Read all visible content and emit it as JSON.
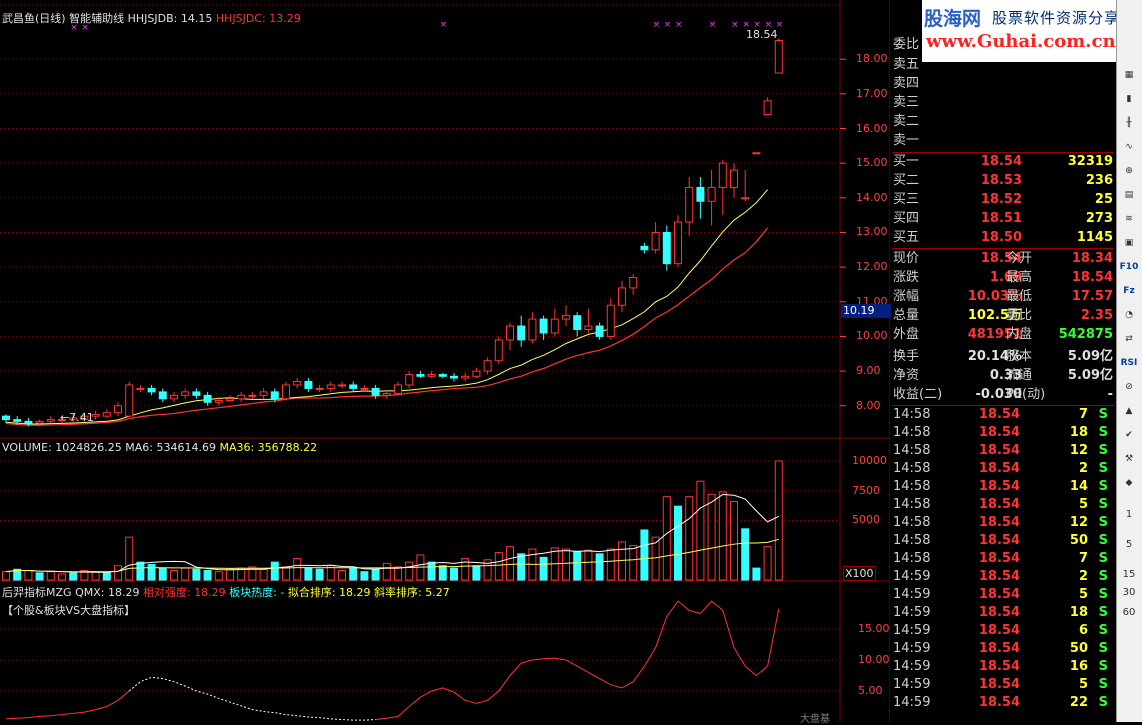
{
  "colors": {
    "up": "#ff3333",
    "down": "#33ffff",
    "ma_short": "#ffff66",
    "ma_long": "#ff3333",
    "grid": "#8b0000"
  },
  "main_chart": {
    "header": {
      "title": "武昌鱼(日线)",
      "indicator": "智能辅助线",
      "hhjsjdb_label": "HHJSJDB: 14.15",
      "hhjsjdc_label": "HHJSJDC: 13.29"
    },
    "price_axis": [
      "18.00",
      "17.00",
      "16.00",
      "15.00",
      "14.00",
      "13.00",
      "12.00",
      "11.00",
      "10.00",
      "9.00",
      "8.00"
    ],
    "current_price_tag": "10.19",
    "high_annotation": "18.54",
    "low_annotation": "7.41"
  },
  "volume_chart": {
    "header": {
      "volume": "VOLUME: 1024826.25",
      "ma6": "MA6: 534614.69",
      "ma36": "MA36: 356788.22"
    },
    "axis": [
      "10000",
      "7500",
      "5000"
    ],
    "unit": "X100"
  },
  "indicator_chart": {
    "header": {
      "name": "后羿指标MZG",
      "qmx": "QMX: 18.29",
      "rel_strength": "相对强度: 18.29",
      "sector_heat": "板块热度: -",
      "fit_rank": "拟合排序: 18.29",
      "slope_rank": "斜率排序: 5.27"
    },
    "subtitle": "【个股&板块VS大盘指标】",
    "axis": [
      "15.00",
      "10.00",
      "5.00"
    ],
    "corner_label": "大盘基"
  },
  "chart_data": [
    {
      "type": "candlestick",
      "title": "武昌鱼(日线)",
      "ylim": [
        7.3,
        18.9
      ],
      "candles": [
        [
          7.7,
          7.6,
          7.75,
          7.5
        ],
        [
          7.6,
          7.55,
          7.7,
          7.45
        ],
        [
          7.55,
          7.5,
          7.65,
          7.4
        ],
        [
          7.5,
          7.55,
          7.6,
          7.41
        ],
        [
          7.55,
          7.6,
          7.7,
          7.5
        ],
        [
          7.6,
          7.6,
          7.7,
          7.5
        ],
        [
          7.6,
          7.65,
          7.75,
          7.5
        ],
        [
          7.6,
          7.7,
          7.8,
          7.55
        ],
        [
          7.7,
          7.75,
          7.85,
          7.6
        ],
        [
          7.7,
          7.8,
          7.9,
          7.65
        ],
        [
          7.8,
          8.0,
          8.1,
          7.7
        ],
        [
          7.7,
          8.6,
          8.7,
          7.7
        ],
        [
          8.5,
          8.5,
          8.6,
          8.4
        ],
        [
          8.5,
          8.4,
          8.6,
          8.3
        ],
        [
          8.4,
          8.2,
          8.5,
          8.1
        ],
        [
          8.2,
          8.3,
          8.4,
          8.1
        ],
        [
          8.3,
          8.4,
          8.5,
          8.2
        ],
        [
          8.4,
          8.3,
          8.5,
          8.2
        ],
        [
          8.3,
          8.1,
          8.4,
          8.0
        ],
        [
          8.1,
          8.15,
          8.25,
          8.0
        ],
        [
          8.15,
          8.2,
          8.3,
          8.1
        ],
        [
          8.2,
          8.3,
          8.4,
          8.1
        ],
        [
          8.3,
          8.3,
          8.4,
          8.2
        ],
        [
          8.3,
          8.4,
          8.5,
          8.2
        ],
        [
          8.4,
          8.2,
          8.5,
          8.1
        ],
        [
          8.2,
          8.6,
          8.7,
          8.15
        ],
        [
          8.6,
          8.7,
          8.8,
          8.5
        ],
        [
          8.7,
          8.5,
          8.8,
          8.4
        ],
        [
          8.5,
          8.5,
          8.6,
          8.4
        ],
        [
          8.5,
          8.6,
          8.7,
          8.4
        ],
        [
          8.6,
          8.6,
          8.7,
          8.5
        ],
        [
          8.6,
          8.5,
          8.7,
          8.4
        ],
        [
          8.5,
          8.5,
          8.6,
          8.4
        ],
        [
          8.5,
          8.3,
          8.6,
          8.2
        ],
        [
          8.3,
          8.35,
          8.4,
          8.2
        ],
        [
          8.35,
          8.6,
          8.7,
          8.3
        ],
        [
          8.6,
          8.9,
          9.0,
          8.5
        ],
        [
          8.9,
          8.85,
          9.0,
          8.8
        ],
        [
          8.85,
          8.9,
          9.0,
          8.8
        ],
        [
          8.9,
          8.85,
          8.95,
          8.8
        ],
        [
          8.85,
          8.8,
          8.95,
          8.7
        ],
        [
          8.8,
          8.85,
          8.95,
          8.7
        ],
        [
          8.85,
          9.0,
          9.1,
          8.8
        ],
        [
          9.0,
          9.3,
          9.4,
          8.9
        ],
        [
          9.3,
          9.9,
          10.0,
          9.2
        ],
        [
          9.9,
          10.3,
          10.4,
          9.6
        ],
        [
          10.3,
          9.9,
          10.6,
          9.7
        ],
        [
          9.9,
          10.5,
          10.7,
          9.8
        ],
        [
          10.5,
          10.1,
          10.6,
          9.9
        ],
        [
          10.1,
          10.5,
          10.8,
          10.0
        ],
        [
          10.5,
          10.6,
          10.9,
          10.3
        ],
        [
          10.6,
          10.2,
          10.7,
          10.0
        ],
        [
          10.2,
          10.3,
          10.8,
          10.1
        ],
        [
          10.3,
          10.0,
          10.4,
          9.9
        ],
        [
          10.0,
          10.9,
          11.1,
          9.9
        ],
        [
          10.9,
          11.4,
          11.6,
          10.7
        ],
        [
          11.4,
          11.7,
          11.8,
          11.2
        ],
        [
          12.6,
          12.5,
          12.7,
          12.4
        ],
        [
          12.5,
          13.0,
          13.3,
          12.4
        ],
        [
          13.0,
          12.1,
          13.2,
          11.9
        ],
        [
          12.1,
          13.3,
          13.5,
          12.0
        ],
        [
          13.3,
          14.3,
          14.6,
          12.9
        ],
        [
          14.3,
          13.9,
          14.6,
          13.4
        ],
        [
          13.9,
          14.3,
          14.8,
          13.2
        ],
        [
          14.3,
          15.0,
          15.1,
          13.5
        ],
        [
          14.3,
          14.8,
          15.0,
          14.0
        ],
        [
          14.0,
          14.0,
          14.8,
          13.9
        ],
        [
          15.3,
          15.3,
          15.3,
          15.3
        ],
        [
          16.4,
          16.8,
          16.9,
          16.4
        ],
        [
          17.6,
          18.54,
          18.6,
          17.6
        ]
      ],
      "ma_short_label": "HHJSJDB",
      "ma_short_last": 14.15,
      "ma_long_label": "HHJSJDC",
      "ma_long_last": 13.29
    },
    {
      "type": "bar",
      "title": "VOLUME",
      "ylim": [
        0,
        10500
      ],
      "values": [
        700,
        900,
        800,
        600,
        700,
        500,
        600,
        800,
        700,
        600,
        1200,
        3600,
        1500,
        1300,
        1000,
        800,
        1000,
        900,
        800,
        700,
        900,
        1000,
        1100,
        900,
        1500,
        1100,
        1800,
        1000,
        900,
        1200,
        800,
        1000,
        700,
        900,
        1400,
        1100,
        1500,
        2100,
        1500,
        1200,
        1000,
        1800,
        1200,
        1700,
        2300,
        2800,
        2200,
        2600,
        1900,
        2700,
        2600,
        2400,
        2500,
        2200,
        2600,
        3200,
        2900,
        4200,
        3600,
        7000,
        6200,
        7000,
        8300,
        7200,
        7400,
        6600,
        4300,
        1000,
        2800,
        10000
      ],
      "up": [
        1,
        0,
        1,
        0,
        1,
        1,
        0,
        1,
        1,
        0,
        1,
        1,
        0,
        0,
        0,
        1,
        1,
        0,
        0,
        1,
        1,
        1,
        1,
        1,
        0,
        1,
        1,
        0,
        0,
        1,
        1,
        0,
        0,
        0,
        1,
        1,
        1,
        1,
        0,
        0,
        0,
        1,
        0,
        1,
        1,
        1,
        0,
        1,
        0,
        1,
        1,
        0,
        1,
        0,
        1,
        1,
        1,
        0,
        1,
        1,
        0,
        1,
        1,
        1,
        1,
        1,
        0,
        0,
        1,
        1
      ],
      "ma6_last": 534614.69,
      "ma36_last": 356788.22
    },
    {
      "type": "line",
      "title": "后羿指标MZG",
      "ylim": [
        0,
        20
      ],
      "values": [
        0.5,
        0.6,
        0.7,
        0.9,
        1.0,
        1.2,
        1.4,
        1.6,
        2.0,
        2.5,
        3.5,
        5.0,
        6.5,
        7.2,
        7.0,
        6.5,
        5.8,
        5.0,
        4.5,
        3.8,
        3.2,
        2.6,
        2.0,
        1.7,
        1.5,
        1.2,
        1.0,
        0.8,
        0.7,
        0.5,
        0.4,
        0.3,
        0.3,
        0.4,
        0.6,
        0.9,
        2.5,
        4.0,
        5.0,
        5.5,
        4.8,
        3.5,
        3.0,
        3.5,
        5.0,
        7.5,
        9.5,
        10.0,
        10.2,
        10.3,
        10.0,
        9.0,
        8.0,
        7.0,
        6.0,
        5.5,
        6.5,
        9.0,
        12.0,
        17.0,
        19.5,
        18.0,
        17.5,
        19.5,
        18.0,
        12.0,
        9.0,
        7.5,
        9.0,
        18.29
      ],
      "dashed_until": 33
    }
  ],
  "quote_panel": {
    "commission_label": "委比",
    "sell": [
      {
        "label": "卖五"
      },
      {
        "label": "卖四"
      },
      {
        "label": "卖三"
      },
      {
        "label": "卖二"
      },
      {
        "label": "卖一"
      }
    ],
    "buy": [
      {
        "label": "买一",
        "price": "18.54",
        "vol": "32319"
      },
      {
        "label": "买二",
        "price": "18.53",
        "vol": "236"
      },
      {
        "label": "买三",
        "price": "18.52",
        "vol": "25"
      },
      {
        "label": "买四",
        "price": "18.51",
        "vol": "273"
      },
      {
        "label": "买五",
        "price": "18.50",
        "vol": "1145"
      }
    ],
    "stats": [
      {
        "l1": "现价",
        "v1": "18.54",
        "l2": "今开",
        "v2": "18.34",
        "c1": "#ff3333",
        "c2": "#ff3333"
      },
      {
        "l1": "涨跌",
        "v1": "1.69",
        "l2": "最高",
        "v2": "18.54",
        "c1": "#ff3333",
        "c2": "#ff3333"
      },
      {
        "l1": "涨幅",
        "v1": "10.03%",
        "l2": "最低",
        "v2": "17.57",
        "c1": "#ff3333",
        "c2": "#ff3333"
      },
      {
        "l1": "总量",
        "v1": "102.5万",
        "l2": "量比",
        "v2": "2.35",
        "c1": "#ffff33",
        "c2": "#ff3333"
      },
      {
        "l1": "外盘",
        "v1": "481951",
        "l2": "内盘",
        "v2": "542875",
        "c1": "#ff3333",
        "c2": "#33ff33"
      },
      {
        "l1": "换手",
        "v1": "20.14%",
        "l2": "股本",
        "v2": "5.09亿",
        "c1": "#e0e0e0",
        "c2": "#e0e0e0"
      },
      {
        "l1": "净资",
        "v1": "0.33",
        "l2": "流通",
        "v2": "5.09亿",
        "c1": "#e0e0e0",
        "c2": "#e0e0e0"
      },
      {
        "l1": "收益(二)",
        "v1": "-0.030",
        "l2": "PE(动)",
        "v2": "-",
        "c1": "#e0e0e0",
        "c2": "#e0e0e0"
      }
    ],
    "ticks": [
      {
        "t": "14:58",
        "p": "18.54",
        "v": "7",
        "d": "S"
      },
      {
        "t": "14:58",
        "p": "18.54",
        "v": "18",
        "d": "S"
      },
      {
        "t": "14:58",
        "p": "18.54",
        "v": "12",
        "d": "S"
      },
      {
        "t": "14:58",
        "p": "18.54",
        "v": "2",
        "d": "S"
      },
      {
        "t": "14:58",
        "p": "18.54",
        "v": "14",
        "d": "S"
      },
      {
        "t": "14:58",
        "p": "18.54",
        "v": "5",
        "d": "S"
      },
      {
        "t": "14:58",
        "p": "18.54",
        "v": "12",
        "d": "S"
      },
      {
        "t": "14:58",
        "p": "18.54",
        "v": "50",
        "d": "S"
      },
      {
        "t": "14:58",
        "p": "18.54",
        "v": "7",
        "d": "S"
      },
      {
        "t": "14:59",
        "p": "18.54",
        "v": "2",
        "d": "S"
      },
      {
        "t": "14:59",
        "p": "18.54",
        "v": "5",
        "d": "S"
      },
      {
        "t": "14:59",
        "p": "18.54",
        "v": "18",
        "d": "S"
      },
      {
        "t": "14:59",
        "p": "18.54",
        "v": "6",
        "d": "S"
      },
      {
        "t": "14:59",
        "p": "18.54",
        "v": "50",
        "d": "S"
      },
      {
        "t": "14:59",
        "p": "18.54",
        "v": "16",
        "d": "S"
      },
      {
        "t": "14:59",
        "p": "18.54",
        "v": "5",
        "d": "S"
      },
      {
        "t": "14:59",
        "p": "18.54",
        "v": "22",
        "d": "S"
      }
    ]
  },
  "banner": {
    "logo": "股海网",
    "slogan": "股票软件资源分享",
    "url": "www.Guhai.com.cn"
  },
  "toolbar": {
    "items": [
      "chart-icon",
      "bar-icon",
      "candle-icon",
      "line-icon",
      "zoom-icon",
      "grid-icon",
      "ma-icon",
      "box-icon",
      "f10-icon",
      "fz-icon",
      "pie-icon",
      "arrow-icon",
      "rsi-icon",
      "stop-icon",
      "up-icon",
      "check-icon",
      "tools-icon",
      "marker-icon"
    ],
    "labels": {
      "f10": "F10",
      "fz": "Fz",
      "rsi": "RSI",
      "n1": "1",
      "n5": "5",
      "n15": "15",
      "n30": "30",
      "n60": "60"
    }
  }
}
